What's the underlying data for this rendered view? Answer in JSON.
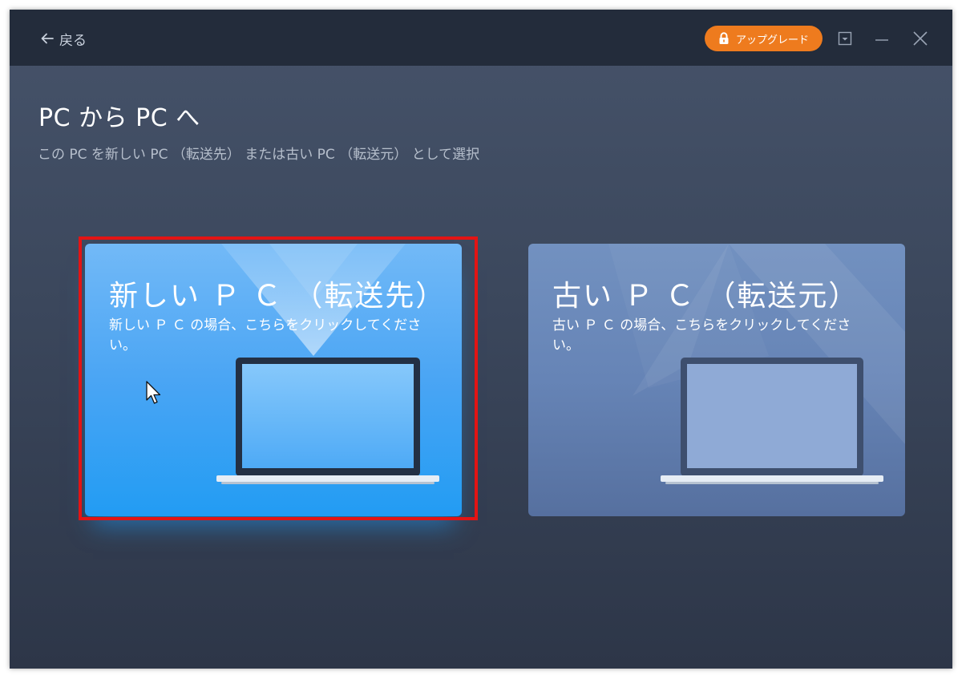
{
  "header": {
    "back_label": "戻る",
    "upgrade_label": "アップグレード"
  },
  "main": {
    "title": "PC から PC へ",
    "subtitle": "この PC を新しい PC （転送先） または古い PC （転送元） として選択"
  },
  "cards": [
    {
      "title": "新しい Ｐ Ｃ （転送先）",
      "description": "新しい Ｐ Ｃ の場合、こちらをクリックしてください。",
      "selected": true
    },
    {
      "title": "古い Ｐ Ｃ （転送元）",
      "description": "古い Ｐ Ｃ の場合、こちらをクリックしてください。",
      "selected": false
    }
  ],
  "colors": {
    "accent_upgrade": "#ee7b1e",
    "selected_card": "#2a9ef4",
    "unselected_card": "#6684b6",
    "highlight_frame": "#e31414",
    "titlebar": "#232c3b"
  },
  "icons": {
    "back": "arrow-left-icon",
    "upgrade": "lock-icon",
    "menu": "dropdown-box-icon",
    "minimize": "minimize-icon",
    "close": "close-icon",
    "card_image": "laptop-icon"
  }
}
